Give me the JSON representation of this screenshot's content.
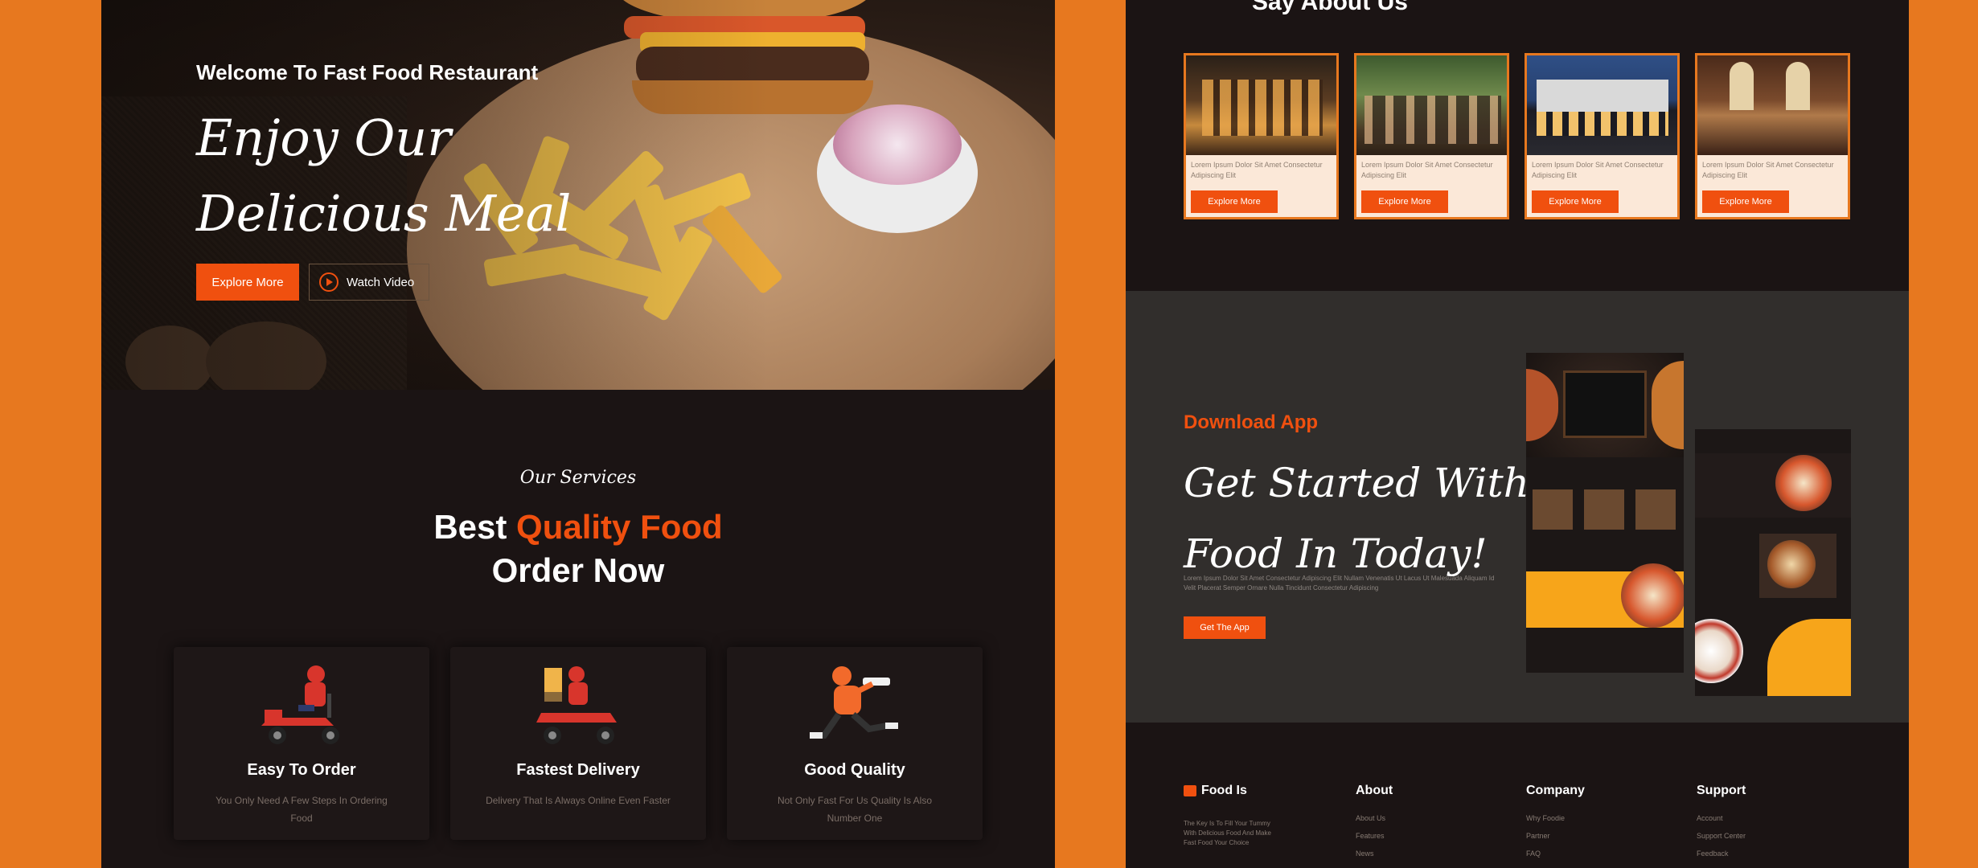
{
  "hero": {
    "subtitle": "Welcome To Fast Food Restaurant",
    "title_line1": "Enjoy Our",
    "title_line2": "Delicious Meal",
    "explore_label": "Explore More",
    "watch_label": "Watch Video"
  },
  "services": {
    "kicker": "Our Services",
    "title_plain": "Best",
    "title_accent": "Quality Food",
    "title_line2": "Order Now",
    "cards": [
      {
        "title": "Easy To Order",
        "desc": "You Only Need A Few Steps In Ordering Food"
      },
      {
        "title": "Fastest Delivery",
        "desc": "Delivery That Is Always Online Even Faster"
      },
      {
        "title": "Good Quality",
        "desc": "Not Only Fast For Us Quality Is Also Number One"
      }
    ]
  },
  "reviews": {
    "title": "Say About Us",
    "cards": [
      {
        "text": "Lorem Ipsum Dolor Sit Amet Consectetur Adipiscing Elit",
        "button": "Explore More"
      },
      {
        "text": "Lorem Ipsum Dolor Sit Amet Consectetur Adipiscing Elit",
        "button": "Explore More"
      },
      {
        "text": "Lorem Ipsum Dolor Sit Amet Consectetur Adipiscing Elit",
        "button": "Explore More"
      },
      {
        "text": "Lorem Ipsum Dolor Sit Amet Consectetur Adipiscing Elit",
        "button": "Explore More"
      }
    ]
  },
  "app": {
    "kicker": "Download App",
    "title_line1": "Get Started With",
    "title_line2": "Food In Today!",
    "desc": "Lorem Ipsum Dolor Sit Amet Consectetur Adipiscing Elit Nullam Venenatis Ut Lacus Ut Malesuada Aliquam Id Velit Placerat Semper Ornare Nulla Tincidunt Consectetur Adipiscing",
    "button": "Get The App"
  },
  "footer": {
    "brand": "Food Is",
    "brand_desc": "The Key Is To Fill Your Tummy With Delicious Food And Make Fast Food Your Choice",
    "columns": [
      {
        "title": "About",
        "items": [
          "About Us",
          "Features",
          "News"
        ]
      },
      {
        "title": "Company",
        "items": [
          "Why Foodie",
          "Partner",
          "FAQ"
        ]
      },
      {
        "title": "Support",
        "items": [
          "Account",
          "Support Center",
          "Feedback"
        ]
      }
    ]
  },
  "colors": {
    "accent": "#f0500f",
    "background": "#e7781f",
    "panel": "#1b1414"
  }
}
